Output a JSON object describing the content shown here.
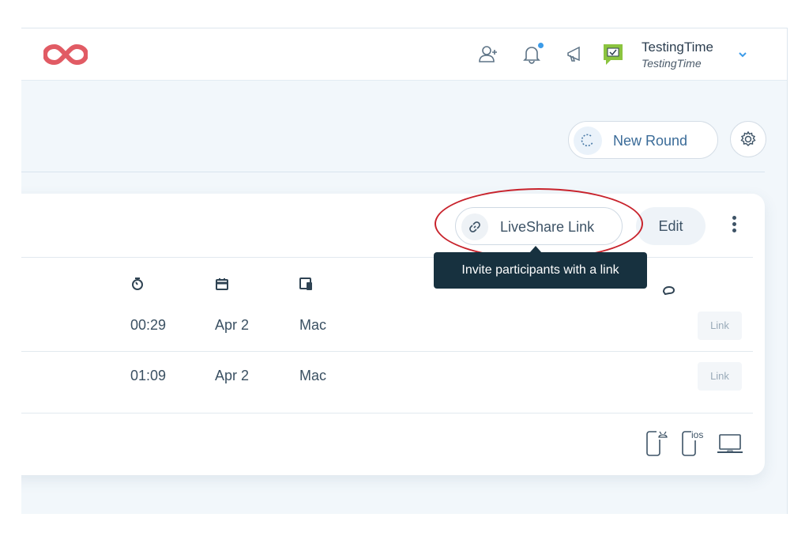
{
  "header": {
    "user_name": "TestingTime",
    "company_name": "TestingTime",
    "brand_color": "#e15b64",
    "accent_color": "#3c9be8"
  },
  "toolbar": {
    "new_round_label": "New Round"
  },
  "card": {
    "liveshare_label": "LiveShare Link",
    "edit_label": "Edit",
    "tooltip": "Invite participants with a link",
    "columns": [
      {
        "icon": "timer-icon"
      },
      {
        "icon": "calendar-icon"
      },
      {
        "icon": "devices-icon"
      },
      {
        "icon": "chat-icon"
      }
    ],
    "rows": [
      {
        "duration": "00:29",
        "date": "Apr 2",
        "device": "Mac",
        "link_label": "Link"
      },
      {
        "duration": "01:09",
        "date": "Apr 2",
        "device": "Mac",
        "link_label": "Link"
      }
    ],
    "footer_icons": [
      "android-phone-icon",
      "ios-phone-icon",
      "laptop-icon"
    ],
    "footer_ios_text": "ios"
  },
  "annotation": {
    "color": "#c8232c"
  }
}
